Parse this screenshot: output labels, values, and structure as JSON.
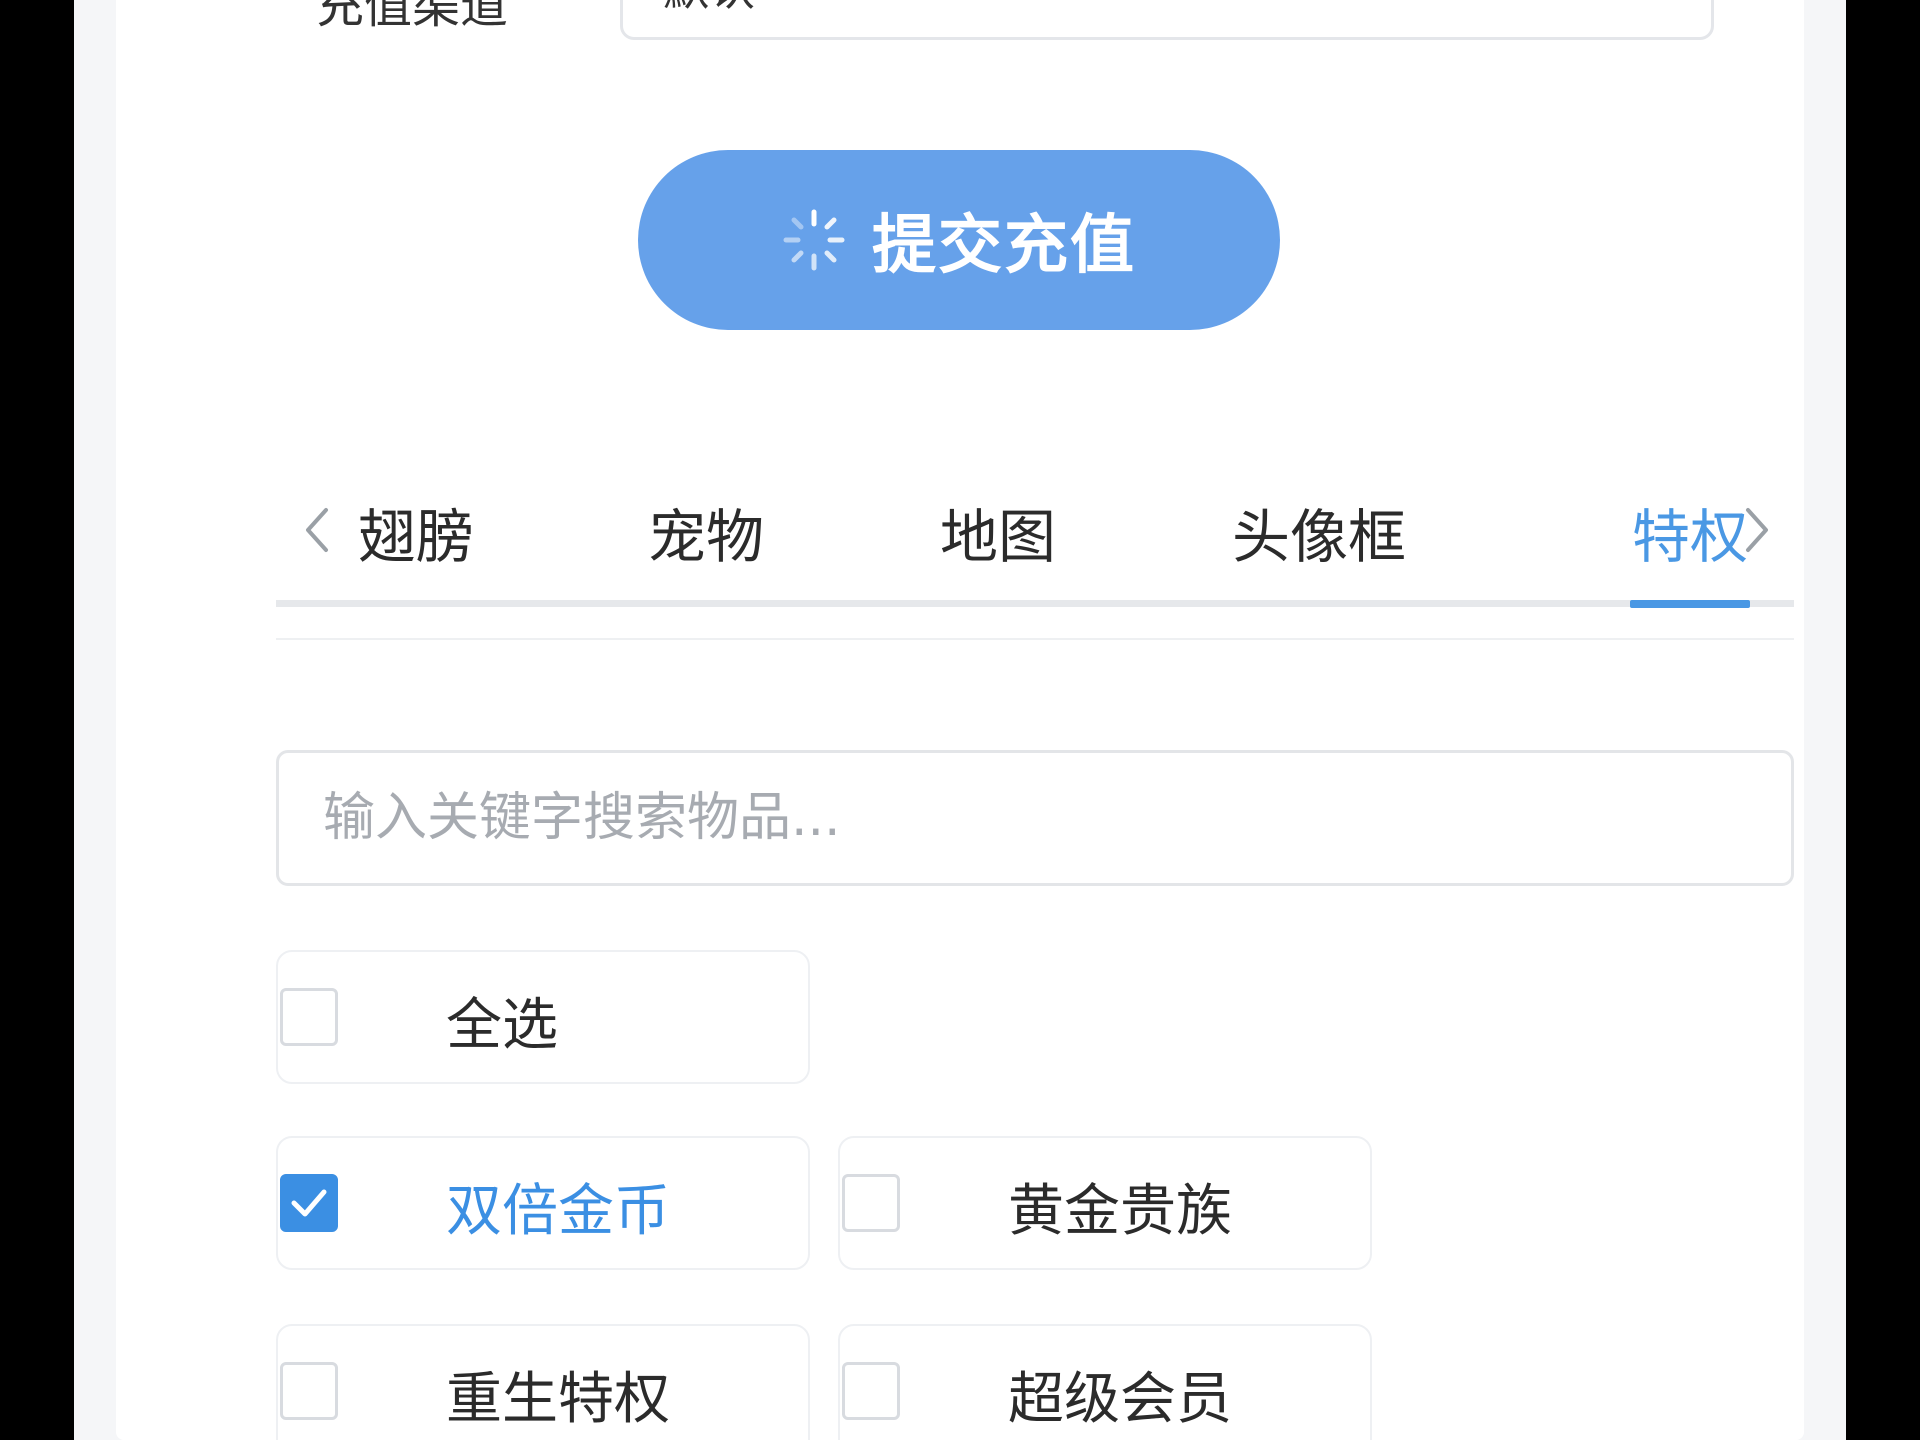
{
  "recharge": {
    "label": "充值渠道",
    "input_value": "默认",
    "submit_label": "提交充值"
  },
  "tabs": [
    {
      "label": "翅膀",
      "active": false
    },
    {
      "label": "宠物",
      "active": false
    },
    {
      "label": "地图",
      "active": false
    },
    {
      "label": "头像框",
      "active": false
    },
    {
      "label": "特权",
      "active": true
    }
  ],
  "search": {
    "placeholder": "输入关键字搜索物品...",
    "value": ""
  },
  "items": [
    {
      "label": "全选",
      "checked": false
    },
    {
      "label": "双倍金币",
      "checked": true
    },
    {
      "label": "黄金贵族",
      "checked": false
    },
    {
      "label": "重生特权",
      "checked": false
    },
    {
      "label": "超级会员",
      "checked": false
    }
  ],
  "colors": {
    "accent": "#3b8fe3",
    "button": "#66a1ea",
    "text": "#2b2b2b",
    "placeholder": "#a7abb1",
    "background": "#f5f6f8"
  },
  "icons": {
    "spinner": "loading-spinner-icon",
    "prev": "chevron-left-icon",
    "next": "chevron-right-icon",
    "check": "checkmark-icon"
  }
}
